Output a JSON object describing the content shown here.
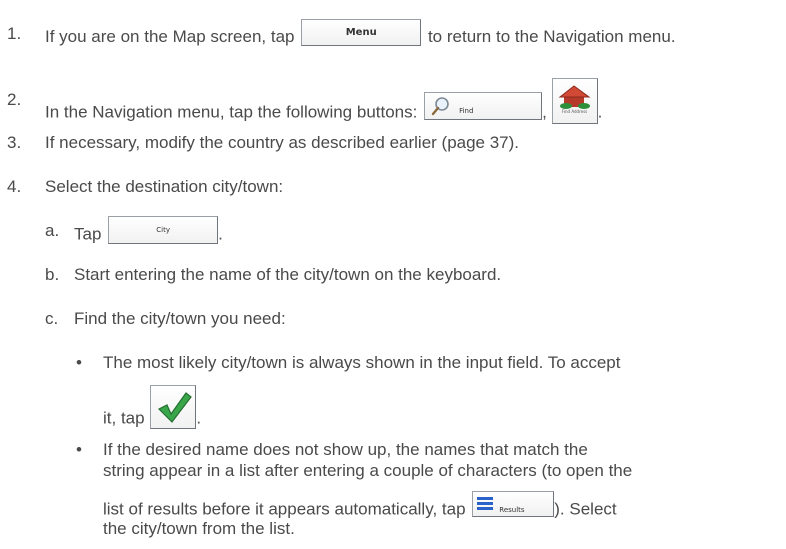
{
  "steps": [
    {
      "num": "1.",
      "pre": "If you are on the Map screen, tap",
      "button": "Menu",
      "post": "to return to the Navigation menu."
    },
    {
      "num": "2.",
      "pre": "In the Navigation menu, tap the following buttons:",
      "button": "Find",
      "button2_label": "Find Address",
      "sep": ",",
      "post": "."
    },
    {
      "num": "3.",
      "text": "If necessary, modify the country as described earlier (page 37)."
    },
    {
      "num": "4.",
      "text": "Select the destination city/town:"
    }
  ],
  "substeps": [
    {
      "num": "a.",
      "pre": "Tap",
      "button": "City",
      "post": "."
    },
    {
      "num": "b.",
      "text": "Start entering the name of the city/town on the keyboard."
    },
    {
      "num": "c.",
      "text": "Find the city/town you need:"
    }
  ],
  "bullets": [
    {
      "mark": "•",
      "line1": "The most likely city/town is always shown in the input field. To accept",
      "line2_pre": "it, tap",
      "line2_post": "."
    },
    {
      "mark": "•",
      "line1": "If the desired name does not show up, the names that match the",
      "line2": "string appear in a list after entering a couple of characters (to open the",
      "line3_pre": "list of results before it appears automatically, tap",
      "button": "Results",
      "line3_post": "). Select",
      "line4": "the city/town from the list."
    }
  ],
  "colors": {
    "text": "#4a4a4a",
    "check": "#3aa64a",
    "results_icon": "#2a62c9"
  }
}
